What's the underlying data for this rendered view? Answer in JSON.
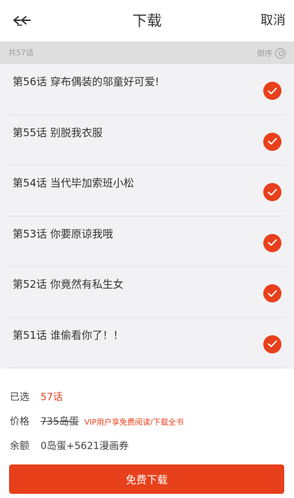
{
  "header": {
    "back_icon": "double-chevron-left-icon",
    "title": "下载",
    "cancel_label": "取消"
  },
  "subbar": {
    "count_label": "共57话",
    "sort_label": "倒序",
    "sort_icon": "sort-circle-icon"
  },
  "chapters": [
    {
      "title": "第56话 穿布偶装的邬童好可爱!",
      "checked": true
    },
    {
      "title": "第55话  别脱我衣服",
      "checked": true
    },
    {
      "title": "第54话 当代毕加索班小松",
      "checked": true
    },
    {
      "title": "第53话 你要原谅我哦",
      "checked": true
    },
    {
      "title": "第52话 你竟然有私生女",
      "checked": true
    },
    {
      "title": "第51话 谁偷看你了！！",
      "checked": true
    }
  ],
  "summary": {
    "selected_label": "已选",
    "selected_value": "57话",
    "price_label": "价格",
    "price_value": "735岛蛋",
    "vip_note": "VIP用户享免费阅读/下载全书",
    "balance_label": "余额",
    "balance_value": "0岛蛋+5621漫画券"
  },
  "download_button_label": "免费下载",
  "colors": {
    "accent": "#e8401c",
    "list_bg": "#f2f2f4",
    "subbar_bg": "#dedede"
  }
}
